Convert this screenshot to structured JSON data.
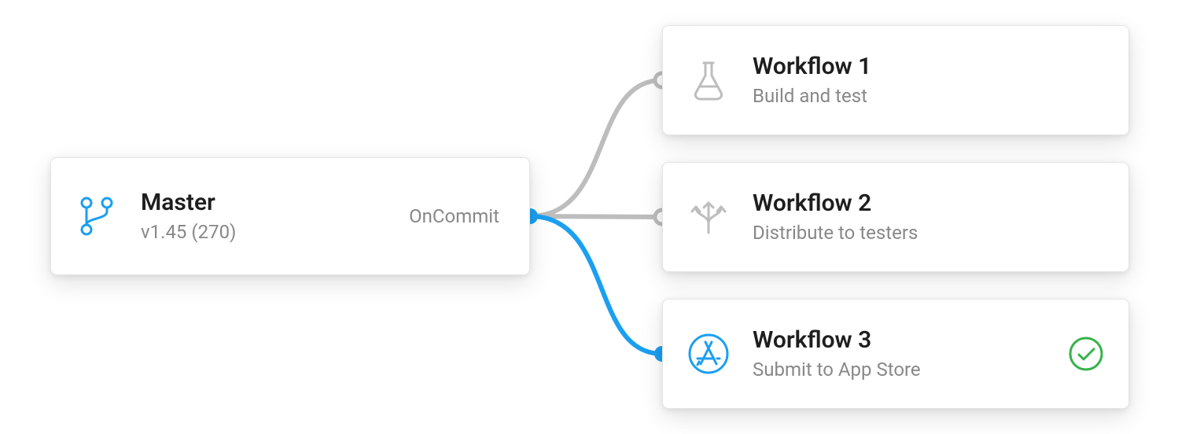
{
  "source": {
    "title": "Master",
    "subtitle": "v1.45 (270)",
    "trigger": "OnCommit",
    "icon": "branch-icon"
  },
  "workflows": [
    {
      "title": "Workflow 1",
      "subtitle": "Build and test",
      "icon": "flask-icon",
      "active": false,
      "status": "none"
    },
    {
      "title": "Workflow 2",
      "subtitle": "Distribute to testers",
      "icon": "distribute-icon",
      "active": false,
      "status": "none"
    },
    {
      "title": "Workflow 3",
      "subtitle": "Submit to App Store",
      "icon": "appstore-icon",
      "active": true,
      "status": "success"
    }
  ],
  "colors": {
    "accent": "#1b9ff1",
    "muted": "#bdbdbd",
    "success": "#36b24a"
  }
}
